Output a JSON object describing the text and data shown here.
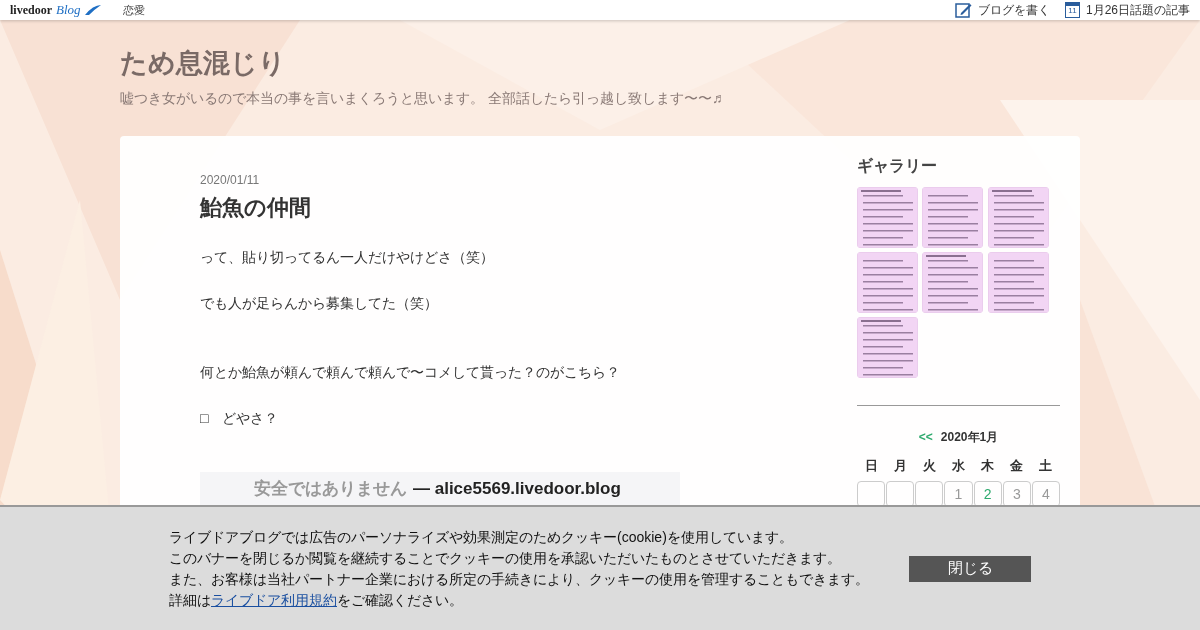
{
  "topbar": {
    "logo_word": "livedoor",
    "logo_script": "Blog",
    "category": "恋愛",
    "links": [
      {
        "kind": "write",
        "label": "ブログを書く"
      },
      {
        "kind": "calendar",
        "label": "1月26日話題の記事",
        "icon_text": "11"
      }
    ]
  },
  "blog": {
    "title": "ため息混じり",
    "description": "嘘つき女がいるので本当の事を言いまくろうと思います。 全部話したら引っ越し致します〜〜♬"
  },
  "article": {
    "date": "2020/01/11",
    "title": "鮐魚の仲間",
    "paragraphs": [
      {
        "kind": "text",
        "text": "って、貼り切ってるん一人だけやけどさ（笑）"
      },
      {
        "kind": "text",
        "text": "でも人が足らんから募集してた（笑）"
      },
      {
        "kind": "spacer"
      },
      {
        "kind": "text",
        "text": "何とか鮐魚が頼んで頼んで頼んで〜コメして貰った？のがこちら？"
      },
      {
        "kind": "text",
        "text": "□　どやさ？"
      },
      {
        "kind": "spacer"
      },
      {
        "kind": "screenshot",
        "warning": "安全ではありません",
        "text": "— alice5569.livedoor.blog"
      }
    ]
  },
  "sidebar": {
    "gallery_title": "ギャラリー",
    "calendar": {
      "prev": "<<",
      "month": "2020年1月",
      "weekdays": [
        "日",
        "月",
        "火",
        "水",
        "木",
        "金",
        "土"
      ],
      "days": [
        {
          "kind": "blank"
        },
        {
          "kind": "blank"
        },
        {
          "kind": "blank"
        },
        {
          "kind": "day",
          "text": "1",
          "linked": false
        },
        {
          "kind": "day",
          "text": "2",
          "linked": true
        },
        {
          "kind": "day",
          "text": "3",
          "linked": false
        },
        {
          "kind": "day",
          "text": "4",
          "linked": false
        }
      ]
    }
  },
  "cookie_banner": {
    "lines": [
      "ライブドアブログでは広告のパーソナライズや効果測定のためクッキー(cookie)を使用しています。",
      "このバナーを閉じるか閲覧を継続することでクッキーの使用を承認いただいたものとさせていただきます。",
      "また、お客様は当社パートナー企業における所定の手続きにより、クッキーの使用を管理することもできます。"
    ],
    "last_prefix": "詳細は",
    "last_link": "ライブドア利用規約",
    "last_suffix": "をご確認ください。",
    "close": "閉じる"
  }
}
